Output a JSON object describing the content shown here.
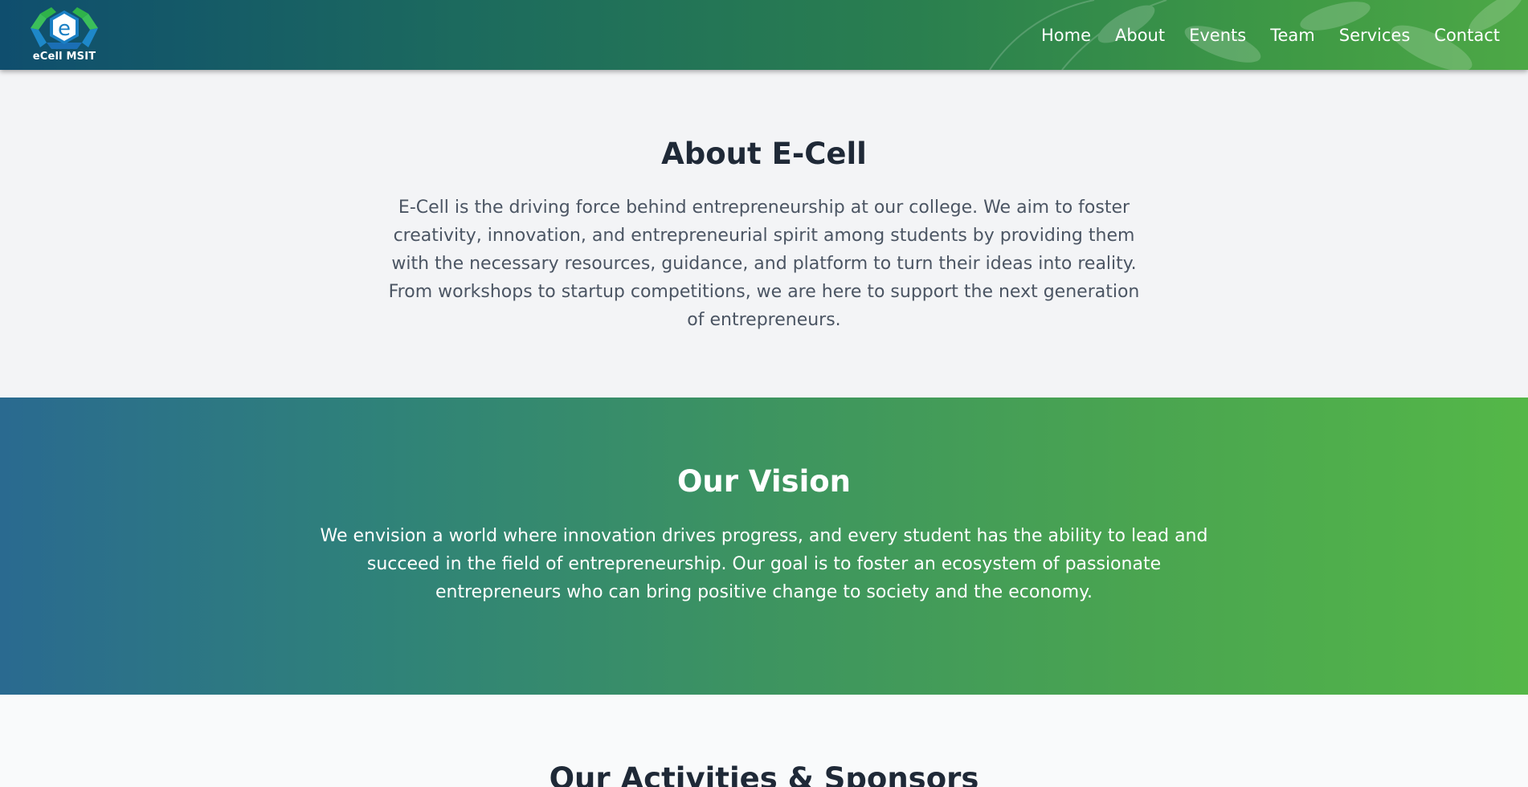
{
  "header": {
    "logo_text": "eCell MSIT",
    "logo_icon": "ecell-hexagon-logo",
    "nav": [
      {
        "label": "Home"
      },
      {
        "label": "About"
      },
      {
        "label": "Events"
      },
      {
        "label": "Team"
      },
      {
        "label": "Services"
      },
      {
        "label": "Contact"
      }
    ],
    "colors": {
      "gradient_start": "#0f4e6e",
      "gradient_end": "#4da846"
    }
  },
  "about": {
    "title": "About E-Cell",
    "text": "E-Cell is the driving force behind entrepreneurship at our college. We aim to foster creativity, innovation, and entrepreneurial spirit among students by providing them with the necessary resources, guidance, and platform to turn their ideas into reality. From workshops to startup competitions, we are here to support the next generation of entrepreneurs."
  },
  "vision": {
    "title": "Our Vision",
    "text": "We envision a world where innovation drives progress, and every student has the ability to lead and succeed in the field of entrepreneurship. Our goal is to foster an ecosystem of passionate entrepreneurs who can bring positive change to society and the economy.",
    "colors": {
      "gradient_start": "#2a6a90",
      "gradient_end": "#54b748"
    }
  },
  "activities": {
    "title": "Our Activities & Sponsors"
  }
}
